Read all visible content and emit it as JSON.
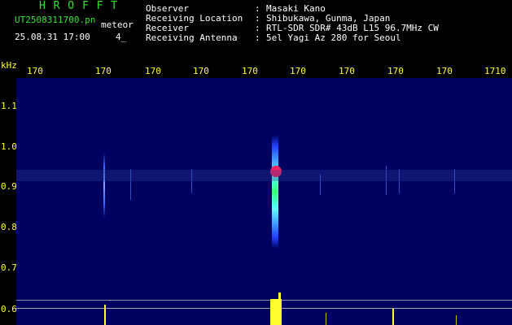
{
  "header": {
    "software": "H R O F F T",
    "filename": "UT2508311700.pn",
    "event_label": "meteor",
    "datetime": "25.08.31 17:00",
    "page_indicator": "4_"
  },
  "info": {
    "rows": [
      {
        "key": "Observer",
        "sep": ":",
        "value": "Masaki Kano"
      },
      {
        "key": "Receiving Location",
        "sep": ":",
        "value": "Shibukawa, Gunma, Japan"
      },
      {
        "key": "Receiver",
        "sep": ":",
        "value": "RTL-SDR SDR# 43dB L15 96.7MHz CW"
      },
      {
        "key": "Receiving Antenna",
        "sep": ":",
        "value": "5el Yagi Az 280 for Seoul"
      }
    ]
  },
  "axes": {
    "freq_unit": "kHz",
    "time_ticks": [
      "170",
      "170",
      "170",
      "170",
      "170",
      "170",
      "170",
      "170",
      "170",
      "1710"
    ],
    "freq_ticks": [
      "1.1",
      "1.0",
      "0.9",
      "0.8",
      "0.7",
      "0.6"
    ]
  },
  "colors": {
    "background": "#000000",
    "spectrogram_bg": "#000060",
    "software_text": "#2ee62e",
    "axis_text": "#ffff30",
    "signal_peak": "#ff2060"
  }
}
